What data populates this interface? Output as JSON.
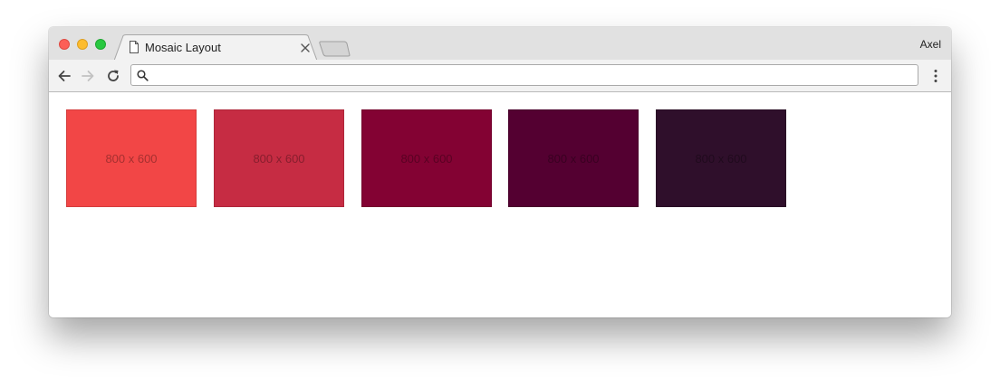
{
  "browser": {
    "tab_title": "Mosaic Layout",
    "profile_name": "Axel",
    "address_value": "",
    "icons": {
      "tab": "doc-icon",
      "tab_close": "close-icon",
      "back": "back-arrow-icon",
      "forward": "forward-arrow-icon",
      "reload": "reload-icon",
      "search": "search-icon",
      "menu": "kebab-menu-icon"
    }
  },
  "tiles": [
    {
      "label": "800 x 600",
      "color": "#f24646"
    },
    {
      "label": "800 x 600",
      "color": "#c62c43"
    },
    {
      "label": "800 x 600",
      "color": "#830233"
    },
    {
      "label": "800 x 600",
      "color": "#540031"
    },
    {
      "label": "800 x 600",
      "color": "#2f0f2b"
    }
  ]
}
